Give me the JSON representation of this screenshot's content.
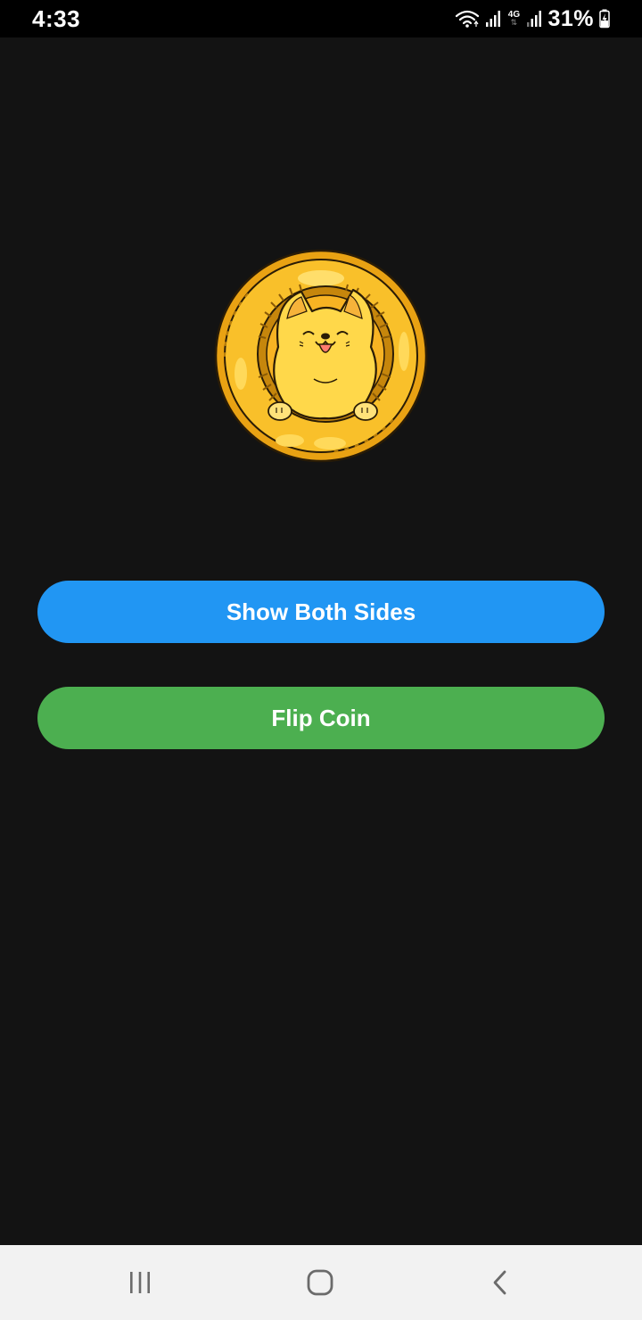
{
  "status_bar": {
    "time": "4:33",
    "network_type": "4G",
    "battery": "31%",
    "icons": [
      "wifi-icon",
      "signal-icon",
      "signal-icon",
      "battery-charging-icon"
    ]
  },
  "coin": {
    "icon": "shiba-dog-coin-icon",
    "colors": {
      "gold": "#f9c02a",
      "gold_light": "#ffd95a",
      "outline": "#2a1c06"
    }
  },
  "buttons": {
    "show_both_sides": "Show Both Sides",
    "flip_coin": "Flip Coin"
  },
  "colors": {
    "background": "#131313",
    "status_bar": "#000000",
    "button_blue": "#2196f3",
    "button_green": "#4caf50",
    "nav_bar": "#f2f2f2"
  },
  "nav_bar": {
    "items": [
      "recent-apps-icon",
      "home-icon",
      "back-icon"
    ]
  }
}
